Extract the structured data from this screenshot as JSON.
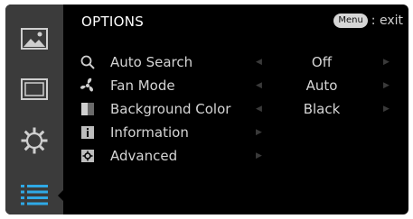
{
  "header": {
    "title": "OPTIONS",
    "menu_key": "Menu",
    "exit_hint": ": exit"
  },
  "sidebar": {
    "items": [
      {
        "name": "picture-tab",
        "icon": "image-icon"
      },
      {
        "name": "screen-tab",
        "icon": "display-icon"
      },
      {
        "name": "settings-tab",
        "icon": "gear-icon"
      },
      {
        "name": "options-tab",
        "icon": "list-icon",
        "active": true
      }
    ]
  },
  "options": [
    {
      "label": "Auto Search",
      "value": "Off",
      "icon": "search-icon"
    },
    {
      "label": "Fan Mode",
      "value": "Auto",
      "icon": "fan-icon"
    },
    {
      "label": "Background Color",
      "value": "Black",
      "icon": "color-icon"
    },
    {
      "label": "Information",
      "icon": "info-icon"
    },
    {
      "label": "Advanced",
      "icon": "gear-small-icon"
    }
  ],
  "colors": {
    "accent": "#2fa9e6",
    "sidebar": "#3b3b3b",
    "background": "#000000"
  }
}
